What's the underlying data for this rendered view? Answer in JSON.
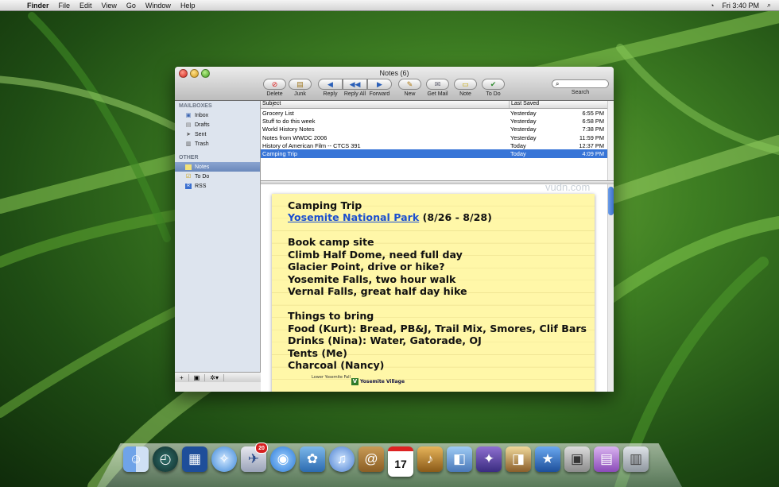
{
  "menubar": {
    "app": "Finder",
    "items": [
      "File",
      "Edit",
      "View",
      "Go",
      "Window",
      "Help"
    ],
    "clock": "Fri 3:40 PM"
  },
  "window": {
    "title": "Notes (6)",
    "toolbar": {
      "delete": "Delete",
      "junk": "Junk",
      "reply": "Reply",
      "reply_all": "Reply All",
      "forward": "Forward",
      "new": "New",
      "get_mail": "Get Mail",
      "note": "Note",
      "todo": "To Do",
      "search": "Search"
    },
    "sidebar": {
      "mailboxes_header": "MAILBOXES",
      "mailboxes": [
        "Inbox",
        "Drafts",
        "Sent",
        "Trash"
      ],
      "other_header": "OTHER",
      "other": [
        "Notes",
        "To Do",
        "RSS"
      ]
    },
    "list": {
      "col_subject": "Subject",
      "col_saved": "Last Saved",
      "rows": [
        {
          "subject": "Grocery List",
          "day": "Yesterday",
          "time": "6:55 PM"
        },
        {
          "subject": "Stuff to do this week",
          "day": "Yesterday",
          "time": "6:58 PM"
        },
        {
          "subject": "World History Notes",
          "day": "Yesterday",
          "time": "7:38 PM"
        },
        {
          "subject": "Notes from WWDC 2006",
          "day": "Yesterday",
          "time": "11:59 PM"
        },
        {
          "subject": "History of American Film -- CTCS 391",
          "day": "Today",
          "time": "12:37 PM"
        },
        {
          "subject": "Camping Trip",
          "day": "Today",
          "time": "4:09 PM"
        }
      ]
    },
    "note": {
      "title": "Camping Trip",
      "link": "Yosemite National Park",
      "dates": " (8/26 - 8/28)",
      "lines1": [
        "Book camp site",
        "Climb Half Dome, need full day",
        "Glacier Point, drive or hike?",
        "Yosemite Falls, two hour walk",
        "Vernal Falls, great half day hike"
      ],
      "heading2": "Things to bring",
      "lines2": [
        "Food (Kurt):  Bread, PB&J, Trail Mix, Smores, Clif Bars",
        "Drinks (Nina):  Water, Gatorade, OJ",
        "Tents (Me)",
        "Charcoal (Nancy)"
      ],
      "map_label1": "Lower Yosemite Fall",
      "map_label2": "Yosemite Village"
    }
  },
  "watermark": "vudn.com",
  "dock": {
    "mail_badge": "20",
    "ical_day": "17"
  }
}
